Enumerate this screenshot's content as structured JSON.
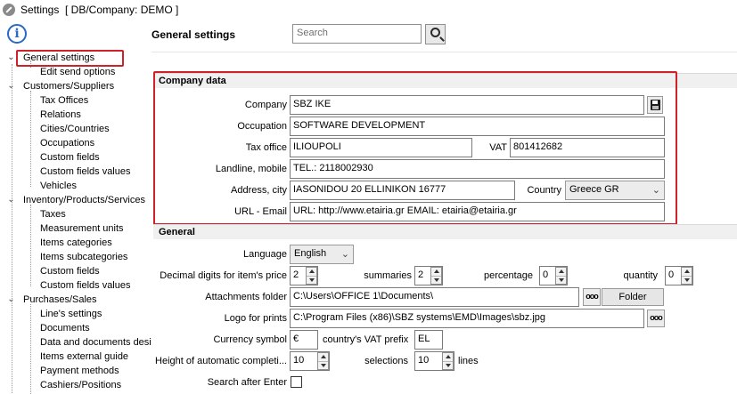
{
  "window": {
    "title": "Settings",
    "context": "[ DB/Company: DEMO ]"
  },
  "tree": {
    "general": "General settings",
    "edit_send": "Edit send options",
    "customers": "Customers/Suppliers",
    "tax_offices": "Tax Offices",
    "relations": "Relations",
    "cities": "Cities/Countries",
    "occupations": "Occupations",
    "custom_fields_1": "Custom fields",
    "custom_fields_values_1": "Custom fields values",
    "vehicles": "Vehicles",
    "inventory": "Inventory/Products/Services",
    "taxes": "Taxes",
    "measurement_units": "Measurement units",
    "items_categories": "Items categories",
    "items_subcategories": "Items subcategories",
    "custom_fields_2": "Custom fields",
    "custom_fields_values_2": "Custom fields values",
    "purchases": "Purchases/Sales",
    "lines_settings": "Line's settings",
    "documents": "Documents",
    "data_documents": "Data and documents desi",
    "items_external": "Items external guide",
    "payment_methods": "Payment methods",
    "cashiers": "Cashiers/Positions"
  },
  "header": {
    "title": "General settings",
    "search_placeholder": "Search"
  },
  "company": {
    "section": "Company data",
    "company_label": "Company",
    "company_value": "SBZ IKE",
    "occupation_label": "Occupation",
    "occupation_value": "SOFTWARE DEVELOPMENT",
    "tax_office_label": "Tax office",
    "tax_office_value": "ILIOUPOLI",
    "vat_label": "VAT",
    "vat_value": "801412682",
    "landline_label": "Landline, mobile",
    "landline_value": "TEL.: 2118002930",
    "address_label": "Address, city",
    "address_value": "IASONIDOU 20 ELLINIKON 16777",
    "country_label": "Country",
    "country_value": "Greece GR",
    "url_label": "URL - Email",
    "url_value": "URL: http://www.etairia.gr EMAIL: etairia@etairia.gr"
  },
  "general": {
    "section": "General",
    "language_label": "Language",
    "language_value": "English",
    "decimal_label": "Decimal digits for item's price",
    "decimal_value": "2",
    "summaries_label": "summaries",
    "summaries_value": "2",
    "percentage_label": "percentage",
    "percentage_value": "0",
    "quantity_label": "quantity",
    "quantity_value": "0",
    "attachments_label": "Attachments folder",
    "attachments_value": "C:\\Users\\OFFICE 1\\Documents\\",
    "folder_button": "Folder",
    "logo_label": "Logo for prints",
    "logo_value": "C:\\Program Files (x86)\\SBZ systems\\EMD\\Images\\sbz.jpg",
    "currency_label": "Currency symbol",
    "currency_value": "€",
    "vat_prefix_label": "country's VAT prefix",
    "vat_prefix_value": "EL",
    "height_label": "Height of automatic completi...",
    "height_value": "10",
    "selections_label": "selections",
    "selections_value": "10",
    "lines_label": "lines",
    "search_enter_label": "Search after Enter"
  },
  "colors": {
    "highlight": "#d0202a",
    "info": "#2b69c4"
  }
}
